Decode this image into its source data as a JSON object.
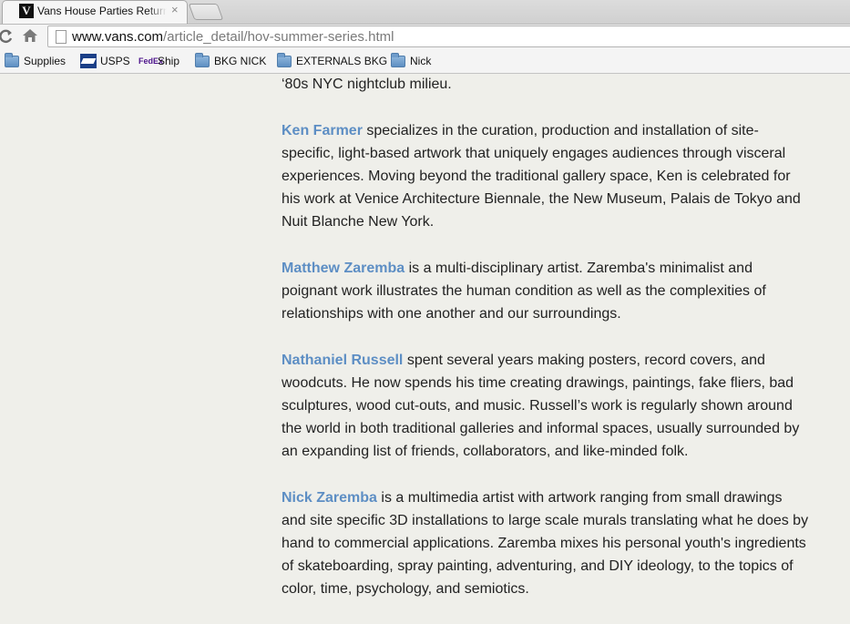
{
  "browser": {
    "tab_title": "Vans House Parties Return",
    "tab_favicon": "V",
    "tab_close": "×",
    "url_host": "www.vans.com",
    "url_path": "/article_detail/hov-summer-series.html"
  },
  "bookmarks": [
    {
      "label": "Supplies",
      "icon": "folder-icon"
    },
    {
      "label": "USPS",
      "icon": "usps-icon"
    },
    {
      "label": "Ship",
      "icon": "fedex-icon"
    },
    {
      "label": "BKG NICK",
      "icon": "folder-icon"
    },
    {
      "label": "EXTERNALS BKG",
      "icon": "folder-icon"
    },
    {
      "label": "Nick",
      "icon": "folder-icon"
    }
  ],
  "fedex_glyph": "FedEx",
  "article": {
    "intro_tail": "‘80s NYC nightclub milieu.",
    "artists": [
      {
        "name": "Ken Farmer",
        "bio": " specializes in the curation, production and installation of site-specific, light-based artwork that uniquely engages audiences through visceral experiences. Moving beyond the traditional gallery space, Ken is celebrated for his work at Venice Architecture Biennale, the New Museum,  Palais de Tokyo and Nuit Blanche New York."
      },
      {
        "name": "Matthew Zaremba",
        "bio": " is a multi-disciplinary artist. Zaremba's minimalist and poignant work illustrates the human condition as well as the complexities of relationships with one another and our surroundings."
      },
      {
        "name": "Nathaniel Russell",
        "bio": " spent several years making posters, record covers, and woodcuts. He now spends his time creating drawings, paintings, fake fliers, bad sculptures, wood cut-outs, and music. Russell’s work is regularly shown around the world in both traditional galleries and informal spaces, usually surrounded by an expanding list of friends, collaborators, and like-minded folk."
      },
      {
        "name": "Nick Zaremba",
        "bio": " is a multimedia artist with artwork ranging from small drawings and site specific 3D installations to large scale murals translating what he does by hand to commercial applications. Zaremba mixes his personal youth's ingredients of skateboarding, spray painting, adventuring, and DIY ideology, to the topics of color, time, psychology, and semiotics."
      }
    ]
  }
}
